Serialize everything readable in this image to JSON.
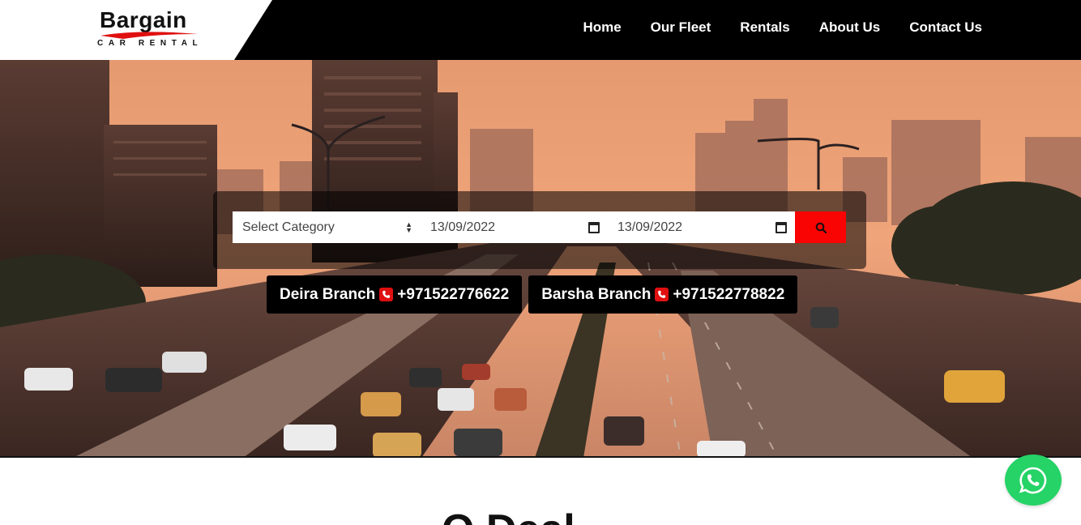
{
  "brand": {
    "name": "Bargain",
    "tagline": "CAR RENTAL",
    "accent": "#e01010"
  },
  "nav": {
    "items": [
      {
        "label": "Home"
      },
      {
        "label": "Our Fleet"
      },
      {
        "label": "Rentals"
      },
      {
        "label": "About Us"
      },
      {
        "label": "Contact Us"
      }
    ]
  },
  "search": {
    "category_value": "Select Category",
    "pickup_date": "13/09/2022",
    "return_date": "13/09/2022",
    "button_icon": "search-icon",
    "button_color": "#f90303"
  },
  "branches": [
    {
      "name": "Deira Branch",
      "phone": "+971522776622",
      "icon": "phone-icon"
    },
    {
      "name": "Barsha Branch",
      "phone": "+971522778822",
      "icon": "phone-icon"
    }
  ],
  "section": {
    "title_partial": "O   Deal"
  },
  "whatsapp": {
    "icon": "whatsapp-icon",
    "color": "#25d366"
  }
}
